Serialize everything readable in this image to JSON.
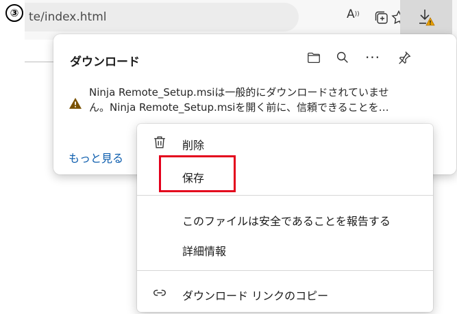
{
  "step_badge": "③",
  "browser": {
    "address_text": "te/index.html",
    "read_aloud_label": "A",
    "icons": {
      "read_aloud": "read-aloud-icon",
      "add_favorite": "add-favorite-icon",
      "favorites": "favorites-icon",
      "collections": "collections-icon",
      "downloads": "downloads-warning-icon"
    }
  },
  "downloads_panel": {
    "title": "ダウンロード",
    "warning_line1": "Ninja Remote_Setup.msiは一般的にダウンロードされていませ",
    "warning_line2": "ん。Ninja Remote_Setup.msiを開く前に、信頼できることを…",
    "see_more": "もっと見る",
    "more_label": "···"
  },
  "context_menu": {
    "items": [
      {
        "label": "削除",
        "icon": "trash-icon"
      },
      {
        "label": "保存",
        "icon": null
      },
      {
        "label": "このファイルは安全であることを報告する",
        "icon": null
      },
      {
        "label": "詳細情報",
        "icon": null
      },
      {
        "label": "ダウンロード リンクのコピー",
        "icon": "link-icon"
      }
    ],
    "highlighted_index": 1
  },
  "colors": {
    "accent_link": "#0b5cad",
    "highlight_red": "#e3001b",
    "warning_amber": "#7a5200"
  }
}
